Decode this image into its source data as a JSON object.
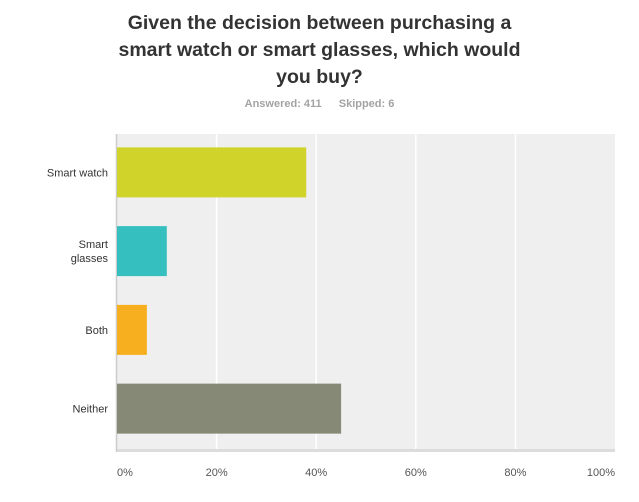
{
  "header": {
    "title_lines": [
      "Given the decision between purchasing a",
      "smart watch or smart glasses, which would",
      "you buy?"
    ],
    "answered": "Answered: 411",
    "skipped": "Skipped: 6"
  },
  "chart_data": {
    "type": "bar",
    "orientation": "horizontal",
    "title": "Given the decision between purchasing a smart watch or smart glasses, which would you buy?",
    "categories": [
      "Smart watch",
      "Smart glasses",
      "Both",
      "Neither"
    ],
    "category_label_lines": [
      [
        "Smart watch"
      ],
      [
        "Smart",
        "glasses"
      ],
      [
        "Both"
      ],
      [
        "Neither"
      ]
    ],
    "values": [
      38,
      10,
      6,
      45
    ],
    "colors": [
      "#D0D42A",
      "#35BFBF",
      "#F7AF1F",
      "#878977"
    ],
    "unit": "%",
    "xlabel": "",
    "ylabel": "",
    "xlim": [
      0,
      100
    ],
    "x_ticks": [
      0,
      20,
      40,
      60,
      80,
      100
    ],
    "x_tick_labels": [
      "0%",
      "20%",
      "40%",
      "60%",
      "80%",
      "100%"
    ],
    "grid": true,
    "legend": "none",
    "plot_background": "#EFEFEF"
  }
}
